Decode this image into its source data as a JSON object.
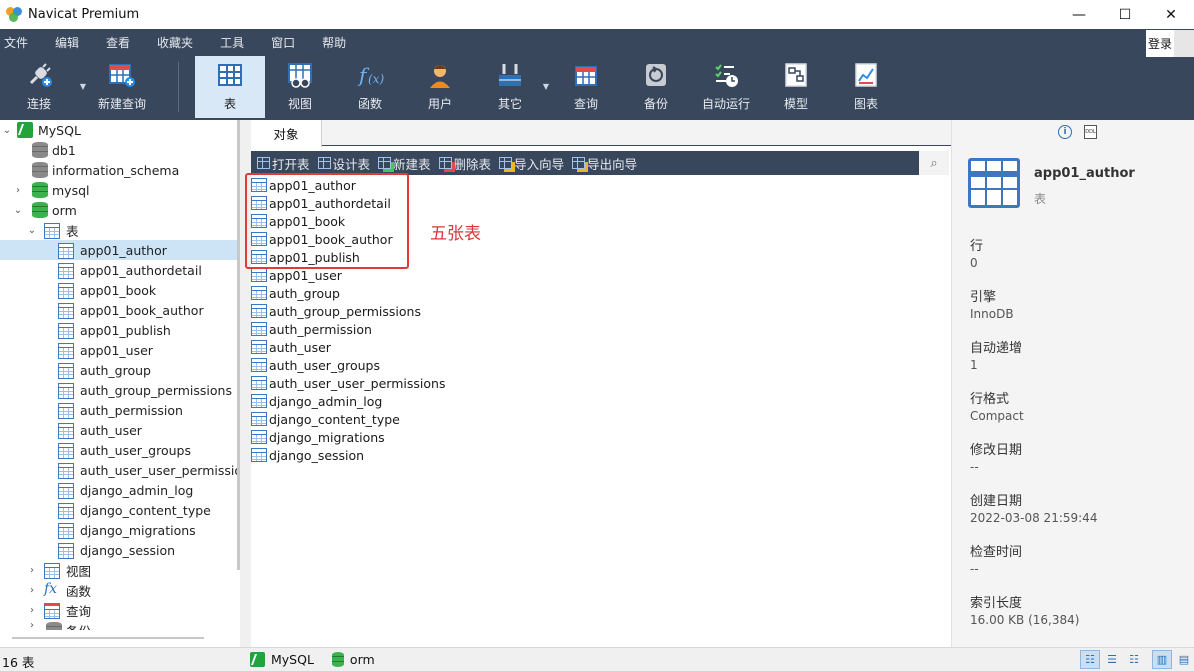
{
  "window": {
    "title": "Navicat Premium",
    "controls": [
      "—",
      "☐",
      "✕"
    ]
  },
  "menu": [
    "文件",
    "编辑",
    "查看",
    "收藏夹",
    "工具",
    "窗口",
    "帮助"
  ],
  "login_label": "登录",
  "toolbar": {
    "connect": "连接",
    "new_query": "新建查询",
    "table": "表",
    "view": "视图",
    "function": "函数",
    "user": "用户",
    "other": "其它",
    "query": "查询",
    "backup": "备份",
    "auto_run": "自动运行",
    "model": "模型",
    "chart": "图表"
  },
  "tree": {
    "connection": "MySQL",
    "databases": [
      "db1",
      "information_schema",
      "mysql",
      "orm"
    ],
    "tables_folder": "表",
    "tables": [
      "app01_author",
      "app01_authordetail",
      "app01_book",
      "app01_book_author",
      "app01_publish",
      "app01_user",
      "auth_group",
      "auth_group_permissions",
      "auth_permission",
      "auth_user",
      "auth_user_groups",
      "auth_user_user_permissio",
      "django_admin_log",
      "django_content_type",
      "django_migrations",
      "django_session"
    ],
    "views_folder": "视图",
    "functions_folder": "函数",
    "queries_folder": "查询",
    "backups_folder": "备份"
  },
  "tab": {
    "objects": "对象"
  },
  "object_toolbar": [
    "打开表",
    "设计表",
    "新建表",
    "删除表",
    "导入向导",
    "导出向导"
  ],
  "objects": [
    "app01_author",
    "app01_authordetail",
    "app01_book",
    "app01_book_author",
    "app01_publish",
    "app01_user",
    "auth_group",
    "auth_group_permissions",
    "auth_permission",
    "auth_user",
    "auth_user_groups",
    "auth_user_user_permissions",
    "django_admin_log",
    "django_content_type",
    "django_migrations",
    "django_session"
  ],
  "annotation": "五张表",
  "info": {
    "name": "app01_author",
    "type": "表",
    "fields": [
      {
        "label": "行",
        "value": "0"
      },
      {
        "label": "引擎",
        "value": "InnoDB"
      },
      {
        "label": "自动递增",
        "value": "1"
      },
      {
        "label": "行格式",
        "value": "Compact"
      },
      {
        "label": "修改日期",
        "value": "--"
      },
      {
        "label": "创建日期",
        "value": "2022-03-08 21:59:44"
      },
      {
        "label": "检查时间",
        "value": "--"
      },
      {
        "label": "索引长度",
        "value": "16.00 KB (16,384)"
      }
    ]
  },
  "status": {
    "count": "16 表",
    "connection": "MySQL",
    "database": "orm"
  },
  "colors": {
    "toolbar_bg": "#39475c",
    "selection": "#cde4f7",
    "annotation_red": "#e23a3a"
  }
}
